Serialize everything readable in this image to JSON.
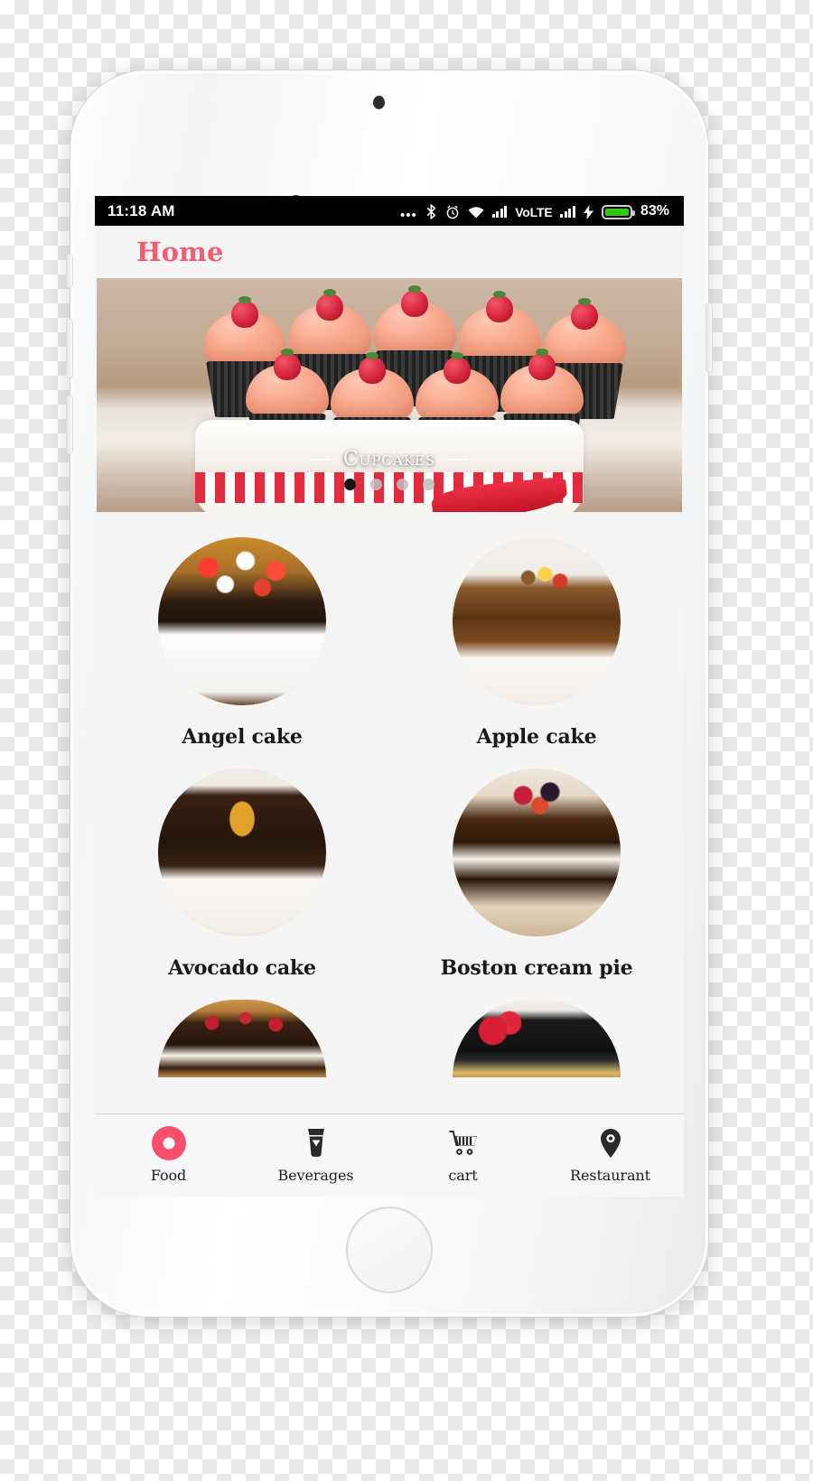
{
  "status_bar": {
    "time": "11:18 AM",
    "icons": [
      "more-dots-icon",
      "bluetooth-icon",
      "alarm-icon",
      "wifi-icon",
      "signal-bars-icon",
      "volte-icon",
      "signal-bars-2-icon",
      "charging-bolt-icon",
      "battery-icon"
    ],
    "volte_label": "VoLTE",
    "battery_percent": "83%"
  },
  "header": {
    "title": "Home"
  },
  "banner": {
    "caption": "Cupcakes",
    "dot_count": 4,
    "active_dot": 0
  },
  "items": [
    {
      "label": "Angel cake",
      "art": "cake-angel"
    },
    {
      "label": "Apple cake",
      "art": "cake-apple"
    },
    {
      "label": "Avocado cake",
      "art": "cake-avocado"
    },
    {
      "label": "Boston cream pie",
      "art": "cake-boston"
    }
  ],
  "partial_items": [
    {
      "art": "cake-black-forest"
    },
    {
      "art": "cake-blackboard"
    }
  ],
  "bottom_nav": {
    "items": [
      {
        "label": "Food",
        "icon": "donut-icon",
        "active": true
      },
      {
        "label": "Beverages",
        "icon": "drink-cup-icon",
        "active": false
      },
      {
        "label": "cart",
        "icon": "shopping-cart-icon",
        "active": false
      },
      {
        "label": "Restaurant",
        "icon": "location-pin-icon",
        "active": false
      }
    ]
  },
  "colors": {
    "accent": "#fa5a70",
    "nav_active": "#fa4f6c",
    "screen_bg": "#f5f5f5",
    "status_bg": "#000000",
    "battery_green": "#2ecc0d"
  }
}
